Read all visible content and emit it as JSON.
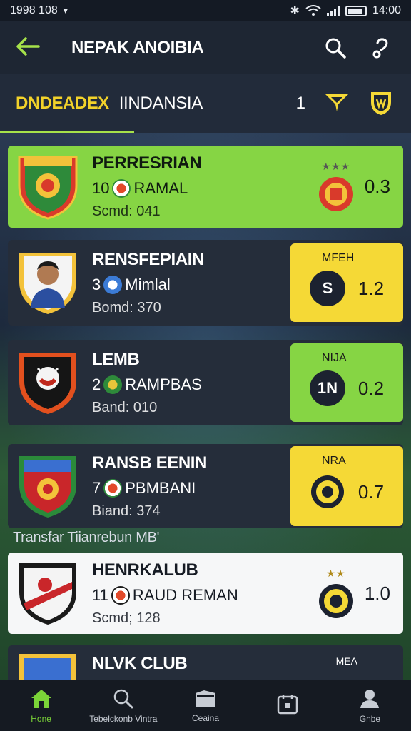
{
  "status_bar": {
    "time_left": "1998 108",
    "time_right": "14:00"
  },
  "app_bar": {
    "title": "NEPAK ANOIBIA"
  },
  "league": {
    "name": "DNDEADEX",
    "subtitle": "IINDANSIA",
    "count": "1"
  },
  "colors": {
    "accent_green": "#86d544",
    "accent_yellow": "#f5d936",
    "league_yellow": "#f2d22a",
    "nav_active": "#7bd438"
  },
  "clubs": [
    {
      "name": "PERRESRIAN",
      "rank": "10",
      "player": "RAMAL",
      "detail": "Scmd: 041",
      "score": "0.3",
      "score_label": "",
      "style": "green"
    },
    {
      "name": "RENSFEPIAIN",
      "rank": "3",
      "player": "Mimlal",
      "detail": "Bomd: 370",
      "score": "1.2",
      "score_label": "MFEH",
      "badge": "S",
      "style": "dark-yellow"
    },
    {
      "name": "LEMB",
      "rank": "2",
      "player": "RAMPBAS",
      "detail": "Band: 010",
      "score": "0.2",
      "score_label": "NIJA",
      "badge": "1N",
      "style": "dark-green"
    },
    {
      "name": "RANSB EENIN",
      "rank": "7",
      "player": "PBMBANI",
      "detail": "Biand: 374",
      "score": "0.7",
      "score_label": "NRA",
      "style": "dark-yellow"
    },
    {
      "name": "HENRKALUB",
      "rank": "11",
      "player": "RAUD REMAN",
      "detail": "Scmd; 128",
      "score": "1.0",
      "score_label": "",
      "style": "white"
    },
    {
      "name": "NLVK CLUB",
      "rank": "",
      "player": "",
      "detail": "",
      "score": "",
      "score_label": "MEA",
      "style": "dark"
    }
  ],
  "section_label": "Transfar Tiianrebun MB'",
  "nav": [
    {
      "label": "Hone",
      "icon": "home-icon",
      "active": true
    },
    {
      "label": "Tebelckonb Vintra",
      "icon": "search-icon",
      "active": false
    },
    {
      "label": "Ceaina",
      "icon": "folder-icon",
      "active": false
    },
    {
      "label": "",
      "icon": "calendar-icon",
      "active": false
    },
    {
      "label": "Gnbe",
      "icon": "profile-icon",
      "active": false
    }
  ]
}
